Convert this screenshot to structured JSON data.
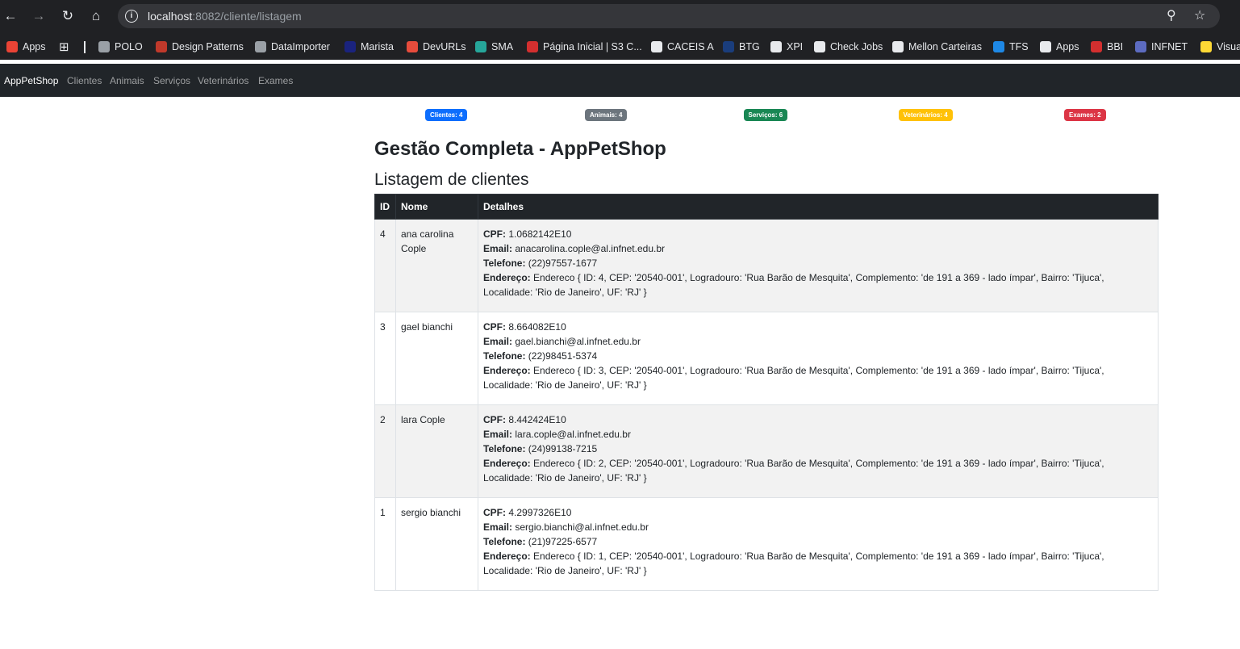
{
  "browser": {
    "url_host": "localhost",
    "url_path": ":8082/cliente/listagem",
    "bookmarks": [
      {
        "label": "Apps",
        "color": "#ea4335"
      },
      {
        "label": "POLO",
        "color": "#9aa0a6"
      },
      {
        "label": "Design Patterns",
        "color": "#c0392b"
      },
      {
        "label": "DataImporter",
        "color": "#9aa0a6"
      },
      {
        "label": "Marista",
        "color": "#1a237e"
      },
      {
        "label": "DevURLs",
        "color": "#e74c3c"
      },
      {
        "label": "SMA",
        "color": "#26a69a"
      },
      {
        "label": "Página Inicial | S3 C...",
        "color": "#d32f2f"
      },
      {
        "label": "CACEIS A",
        "color": "#e8eaed"
      },
      {
        "label": "BTG",
        "color": "#1a3d7c"
      },
      {
        "label": "XPI",
        "color": "#e8eaed"
      },
      {
        "label": "Check Jobs",
        "color": "#e8eaed"
      },
      {
        "label": "Mellon Carteiras",
        "color": "#e8eaed"
      },
      {
        "label": "TFS",
        "color": "#1e88e5"
      },
      {
        "label": "Apps",
        "color": "#e8eaed"
      },
      {
        "label": "BBI",
        "color": "#d32f2f"
      },
      {
        "label": "INFNET",
        "color": "#5c6bc0"
      },
      {
        "label": "Visual",
        "color": "#fdd835"
      }
    ]
  },
  "navbar": {
    "brand": "AppPetShop",
    "links": [
      "Clientes",
      "Animais",
      "Serviços",
      "Veterinários",
      "Exames"
    ]
  },
  "badges": [
    {
      "label": "Clientes: 4",
      "color": "#0d6efd"
    },
    {
      "label": "Animais: 4",
      "color": "#6c757d"
    },
    {
      "label": "Serviços: 6",
      "color": "#198754"
    },
    {
      "label": "Veterinários: 4",
      "color": "#ffc107"
    },
    {
      "label": "Exames: 2",
      "color": "#dc3545"
    }
  ],
  "page": {
    "title": "Gestão Completa - AppPetShop",
    "subtitle": "Listagem de clientes"
  },
  "table": {
    "headers": [
      "ID",
      "Nome",
      "Detalhes"
    ],
    "labels": {
      "cpf": "CPF:",
      "email": "Email:",
      "telefone": "Telefone:",
      "endereco": "Endereço:"
    },
    "rows": [
      {
        "id": "4",
        "nome": "ana carolina Cople",
        "cpf": "1.0682142E10",
        "email": "anacarolina.cople@al.infnet.edu.br",
        "telefone": "(22)97557-1677",
        "endereco": "Endereco { ID: 4, CEP: '20540-001', Logradouro: 'Rua Barão de Mesquita', Complemento: 'de 191 a 369 - lado ímpar', Bairro: 'Tijuca', Localidade: 'Rio de Janeiro', UF: 'RJ' }"
      },
      {
        "id": "3",
        "nome": "gael bianchi",
        "cpf": "8.664082E10",
        "email": "gael.bianchi@al.infnet.edu.br",
        "telefone": "(22)98451-5374",
        "endereco": "Endereco { ID: 3, CEP: '20540-001', Logradouro: 'Rua Barão de Mesquita', Complemento: 'de 191 a 369 - lado ímpar', Bairro: 'Tijuca', Localidade: 'Rio de Janeiro', UF: 'RJ' }"
      },
      {
        "id": "2",
        "nome": "lara Cople",
        "cpf": "8.442424E10",
        "email": "lara.cople@al.infnet.edu.br",
        "telefone": "(24)99138-7215",
        "endereco": "Endereco { ID: 2, CEP: '20540-001', Logradouro: 'Rua Barão de Mesquita', Complemento: 'de 191 a 369 - lado ímpar', Bairro: 'Tijuca', Localidade: 'Rio de Janeiro', UF: 'RJ' }"
      },
      {
        "id": "1",
        "nome": "sergio bianchi",
        "cpf": "4.2997326E10",
        "email": "sergio.bianchi@al.infnet.edu.br",
        "telefone": "(21)97225-6577",
        "endereco": "Endereco { ID: 1, CEP: '20540-001', Logradouro: 'Rua Barão de Mesquita', Complemento: 'de 191 a 369 - lado ímpar', Bairro: 'Tijuca', Localidade: 'Rio de Janeiro', UF: 'RJ' }"
      }
    ]
  }
}
